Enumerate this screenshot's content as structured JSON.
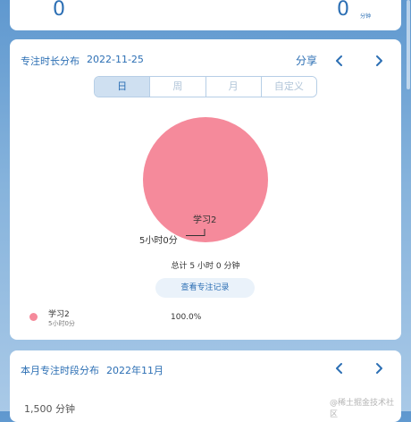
{
  "stats": {
    "left_value": "0",
    "right_value": "0",
    "right_unit": "分钟"
  },
  "distribution": {
    "title": "专注时长分布",
    "date": "2022-11-25",
    "share_label": "分享",
    "tabs": [
      {
        "label": "日",
        "active": true
      },
      {
        "label": "周",
        "active": false
      },
      {
        "label": "月",
        "active": false
      },
      {
        "label": "自定义",
        "active": false
      }
    ],
    "pie_label": "学习2",
    "pie_value_label": "5小时0分",
    "total_text": "总计 5 小时 0 分钟",
    "view_button": "查看专注记录",
    "legend": [
      {
        "name": "学习2",
        "duration": "5小时0分",
        "percent": "100.0%"
      }
    ]
  },
  "month": {
    "title": "本月专注时段分布",
    "date": "2022年11月",
    "y_label": "1,500 分钟"
  },
  "watermark": "@稀土掘金技术社区",
  "icons": {
    "prev": "chevron-left-icon",
    "next": "chevron-right-icon"
  },
  "colors": {
    "accent": "#2c6fb4",
    "pie": "#f58a9b",
    "background_top": "#5f98cf",
    "background_bottom": "#a9c9e7"
  },
  "chart_data": {
    "type": "pie",
    "categories": [
      "学习2"
    ],
    "values": [
      100.0
    ],
    "data_labels": [
      "5小时0分"
    ]
  }
}
